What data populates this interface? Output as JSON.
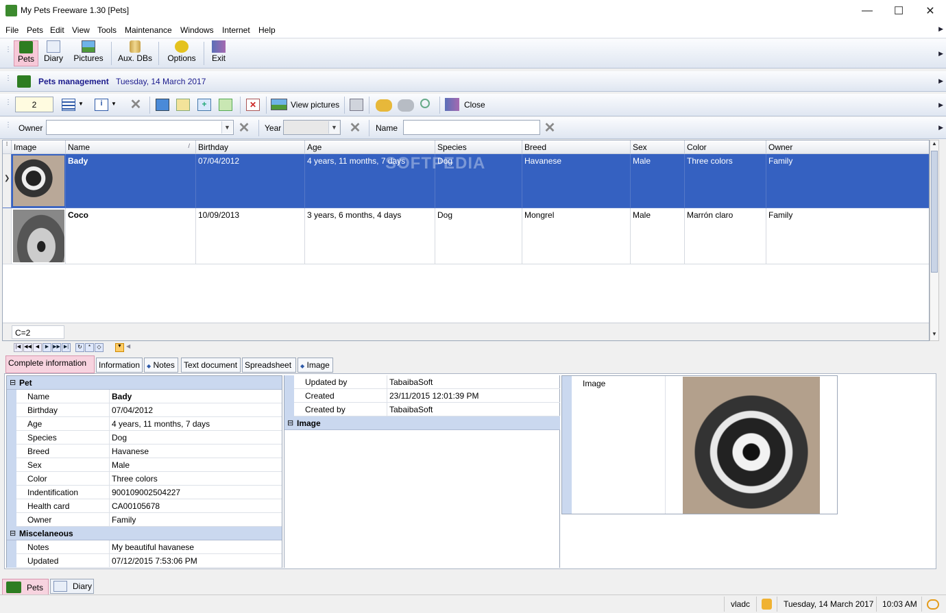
{
  "window": {
    "title": "My Pets Freeware 1.30 [Pets]"
  },
  "menu": [
    "File",
    "Pets",
    "Edit",
    "View",
    "Tools",
    "Maintenance",
    "Windows",
    "Internet",
    "Help"
  ],
  "toolbar": {
    "items": [
      "Pets",
      "Diary",
      "Pictures",
      "Aux. DBs",
      "Options",
      "Exit"
    ]
  },
  "header": {
    "title": "Pets management",
    "date": "Tuesday, 14 March 2017"
  },
  "actions": {
    "record_count": "2",
    "view_pictures": "View pictures",
    "close": "Close"
  },
  "filter": {
    "owner_label": "Owner",
    "year_label": "Year",
    "name_label": "Name"
  },
  "grid": {
    "columns": [
      "Image",
      "Name",
      "Birthday",
      "Age",
      "Species",
      "Breed",
      "Sex",
      "Color",
      "Owner"
    ],
    "rows": [
      {
        "name": "Bady",
        "birthday": "07/04/2012",
        "age": "4 years, 11 months, 7 days",
        "species": "Dog",
        "breed": "Havanese",
        "sex": "Male",
        "color": "Three colors",
        "owner": "Family"
      },
      {
        "name": "Coco",
        "birthday": "10/09/2013",
        "age": "3 years, 6 months, 4 days",
        "species": "Dog",
        "breed": "Mongrel",
        "sex": "Male",
        "color": "Marrón claro",
        "owner": "Family"
      }
    ],
    "footer_count": "C=2",
    "watermark": "SOFTPEDIA"
  },
  "tabs": [
    "Complete information",
    "Information",
    "Notes",
    "Text document",
    "Spreadsheet",
    "Image"
  ],
  "details": {
    "pet_header": "Pet",
    "pet": [
      {
        "k": "Name",
        "v": "Bady"
      },
      {
        "k": "Birthday",
        "v": "07/04/2012"
      },
      {
        "k": "Age",
        "v": "4 years, 11 months, 7 days"
      },
      {
        "k": "Species",
        "v": "Dog"
      },
      {
        "k": "Breed",
        "v": "Havanese"
      },
      {
        "k": "Sex",
        "v": "Male"
      },
      {
        "k": "Color",
        "v": "Three colors"
      },
      {
        "k": "Indentification",
        "v": "900109002504227"
      },
      {
        "k": "Health card",
        "v": "CA00105678"
      },
      {
        "k": "Owner",
        "v": "Family"
      }
    ],
    "misc_header": "Miscelaneous",
    "misc": [
      {
        "k": "Notes",
        "v": "My beautiful havanese"
      },
      {
        "k": "Updated",
        "v": "07/12/2015 7:53:06 PM"
      }
    ],
    "mid": [
      {
        "k": "Updated by",
        "v": "TabaibaSoft"
      },
      {
        "k": "Created",
        "v": "23/11/2015 12:01:39 PM"
      },
      {
        "k": "Created by",
        "v": "TabaibaSoft"
      }
    ],
    "image_header": "Image",
    "image_label": "Image"
  },
  "bottom_tabs": [
    "Pets",
    "Diary"
  ],
  "status": {
    "user": "vladc",
    "date": "Tuesday, 14 March 2017",
    "time": "10:03 AM"
  },
  "colors": {
    "selection": "#3561c1",
    "title_blue": "#1a1a8c",
    "group_header": "#cad8ef"
  }
}
